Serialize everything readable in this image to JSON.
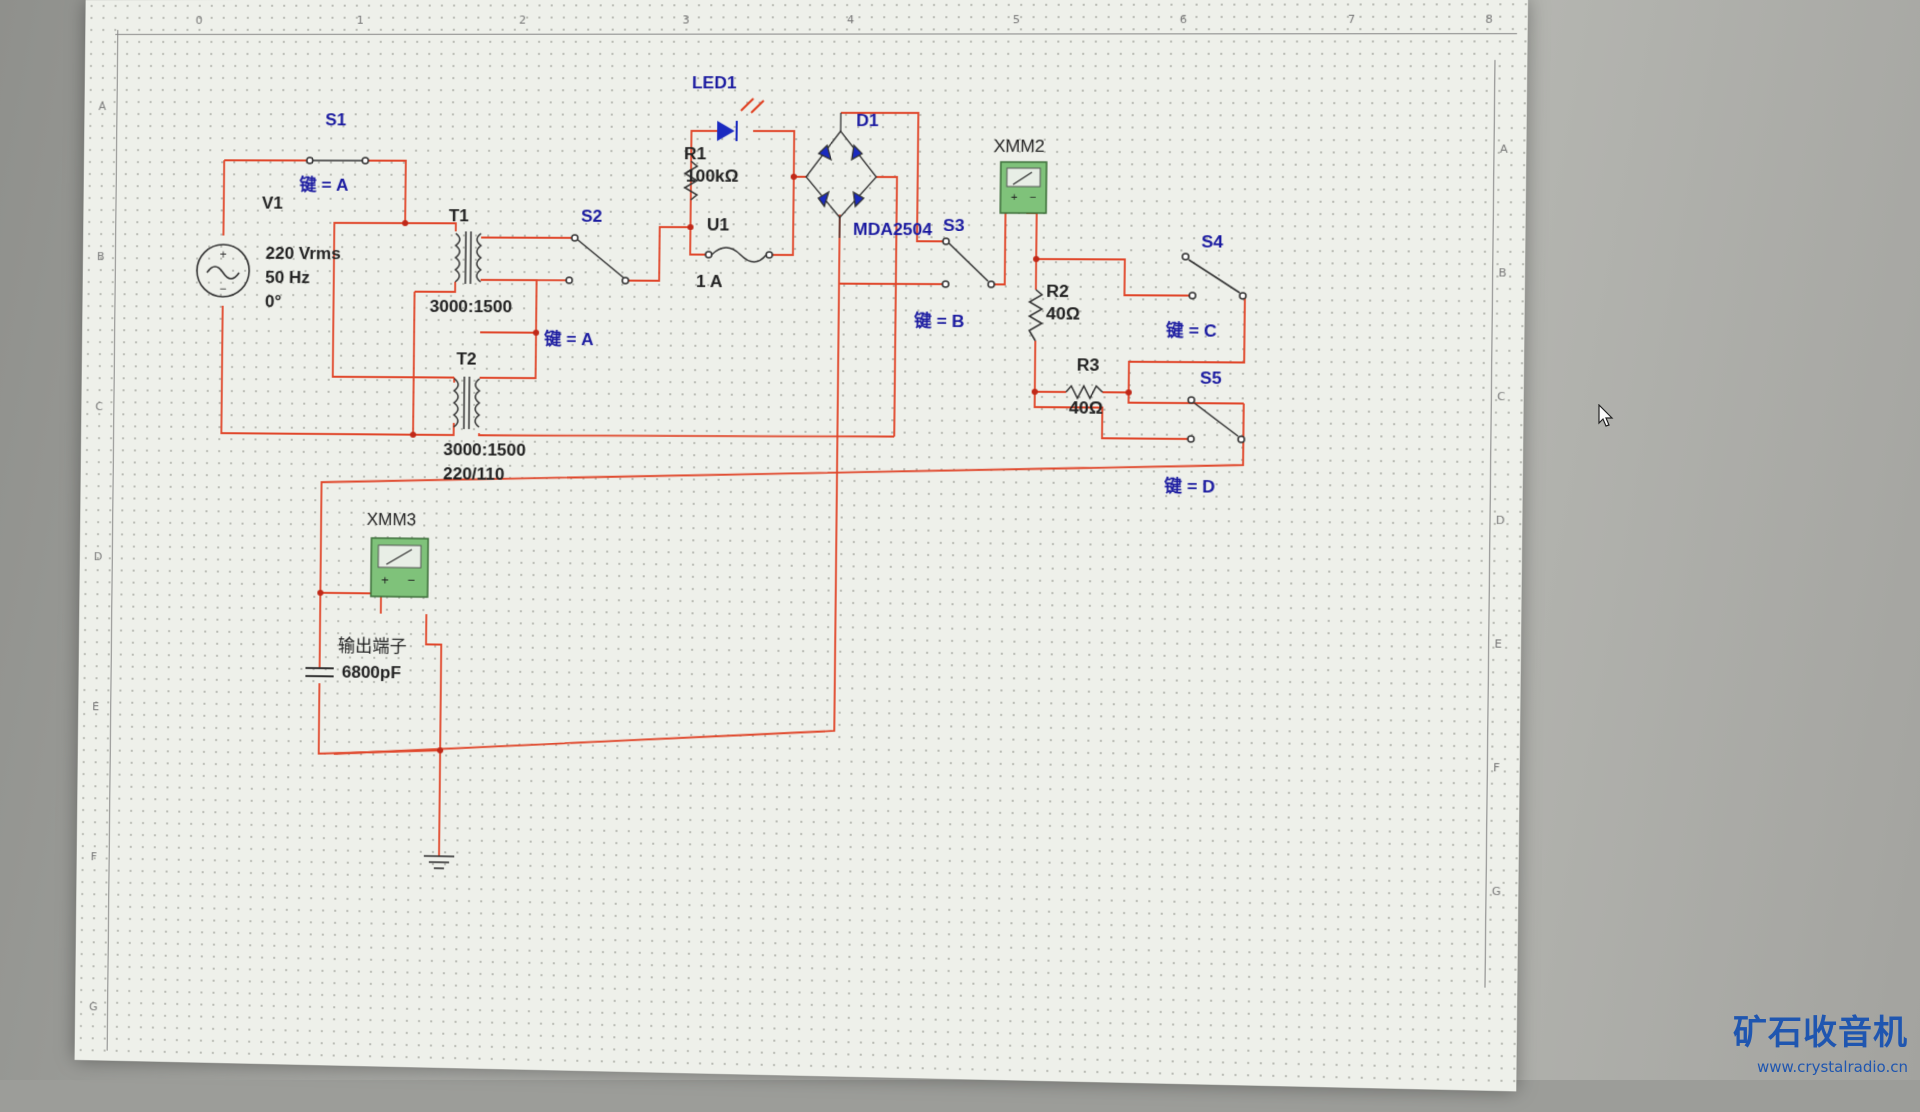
{
  "rulers": {
    "top": [
      "0",
      "1",
      "2",
      "3",
      "4",
      "5",
      "6",
      "7",
      "8"
    ],
    "left": [
      "A",
      "B",
      "C",
      "D",
      "E",
      "F",
      "G"
    ],
    "right": [
      "A",
      "B",
      "C",
      "D",
      "E",
      "F",
      "G"
    ]
  },
  "components": {
    "S1": {
      "name": "S1",
      "key": "键 = A"
    },
    "V1": {
      "name": "V1",
      "voltage": "220 Vrms",
      "freq": "50 Hz",
      "phase": "0°"
    },
    "T1": {
      "name": "T1",
      "ratio": "3000:1500"
    },
    "T2": {
      "name": "T2",
      "ratio": "3000:1500",
      "sub": "220/110"
    },
    "S2": {
      "name": "S2",
      "key": "键 = A"
    },
    "LED1": {
      "name": "LED1"
    },
    "R1": {
      "name": "R1",
      "value": "100kΩ"
    },
    "U1": {
      "name": "U1",
      "value": "1 A"
    },
    "D1": {
      "name": "D1",
      "model": "MDA2504"
    },
    "S3": {
      "name": "S3",
      "key": "键 = B"
    },
    "XMM2": {
      "name": "XMM2"
    },
    "R2": {
      "name": "R2",
      "value": "40Ω"
    },
    "R3": {
      "name": "R3",
      "value": "40Ω"
    },
    "S4": {
      "name": "S4",
      "key": "键 = C"
    },
    "S5": {
      "name": "S5",
      "key": "键 = D"
    },
    "XMM3": {
      "name": "XMM3"
    },
    "C1": {
      "label": "输出端子",
      "value": "6800pF"
    }
  },
  "watermark": {
    "logo": "矿石收音机",
    "url": "www.crystalradio.cn"
  },
  "colors": {
    "wire": "#e0462a",
    "label": "#1a1aa0",
    "text": "#222222",
    "meter": "#7fc27a"
  }
}
